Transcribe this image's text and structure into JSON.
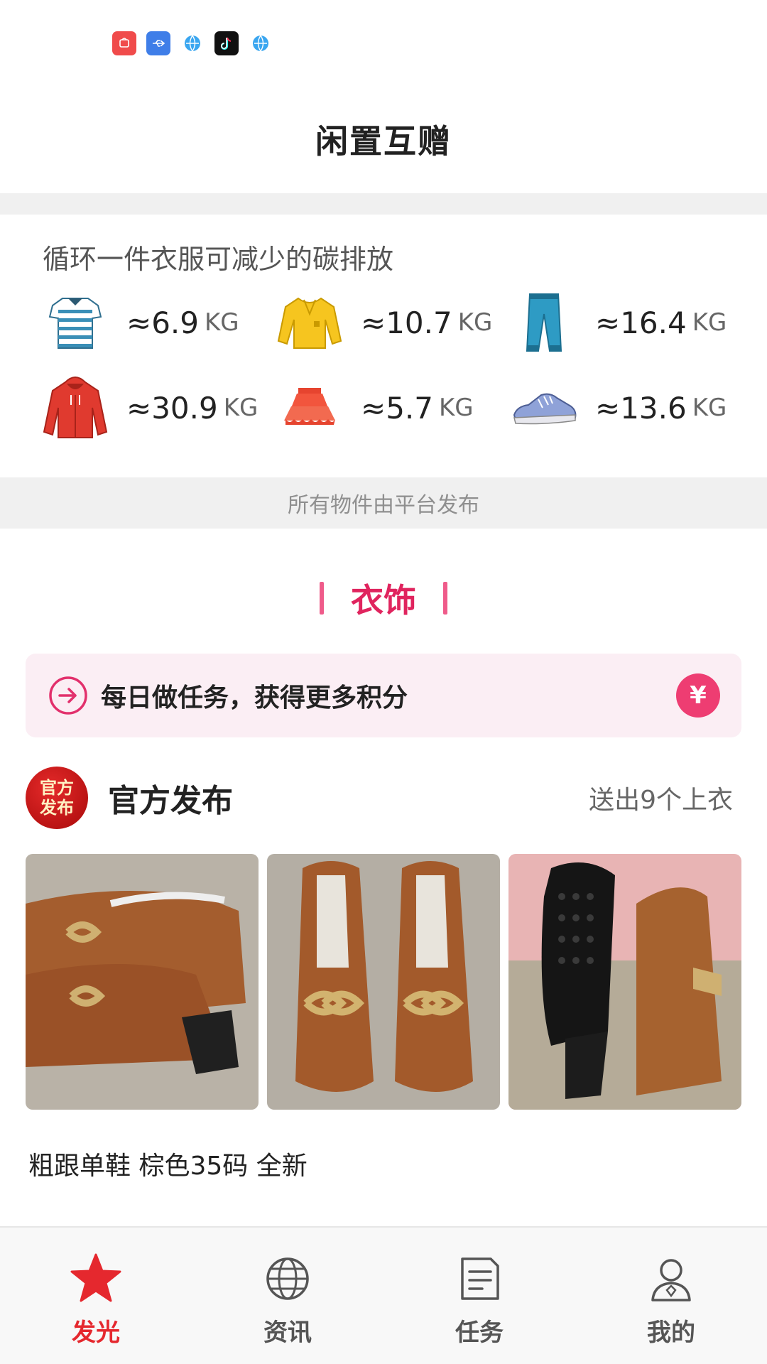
{
  "status_bar": {
    "icons": [
      "huawei-app-icon",
      "usb-icon",
      "browser-icon",
      "tiktok-icon",
      "browser-icon"
    ]
  },
  "header": {
    "title": "闲置互赠"
  },
  "carbon": {
    "heading": "循环一件衣服可减少的碳排放",
    "items": [
      {
        "icon": "tshirt-icon",
        "value": "≈6.9",
        "unit": "KG"
      },
      {
        "icon": "sweater-icon",
        "value": "≈10.7",
        "unit": "KG"
      },
      {
        "icon": "jeans-icon",
        "value": "≈16.4",
        "unit": "KG"
      },
      {
        "icon": "hoodie-icon",
        "value": "≈30.9",
        "unit": "KG"
      },
      {
        "icon": "skirt-icon",
        "value": "≈5.7",
        "unit": "KG"
      },
      {
        "icon": "sneaker-icon",
        "value": "≈13.6",
        "unit": "KG"
      }
    ]
  },
  "note": "所有物件由平台发布",
  "category": {
    "title": "衣饰"
  },
  "task_banner": {
    "text": "每日做任务，获得更多积分",
    "coin": "¥"
  },
  "official": {
    "badge": "官方发布",
    "title": "官方发布",
    "count": "送出9个上衣"
  },
  "listing": {
    "title": "粗跟单鞋 棕色35码 全新"
  },
  "nav": {
    "items": [
      {
        "label": "发光",
        "icon": "star-icon",
        "active": true
      },
      {
        "label": "资讯",
        "icon": "globe-icon",
        "active": false
      },
      {
        "label": "任务",
        "icon": "document-icon",
        "active": false
      },
      {
        "label": "我的",
        "icon": "user-icon",
        "active": false
      }
    ]
  },
  "colors": {
    "accent": "#e0245e",
    "nav_active": "#e5282e",
    "banner_bg": "#fbeef4",
    "band": "#f0f0f0"
  }
}
